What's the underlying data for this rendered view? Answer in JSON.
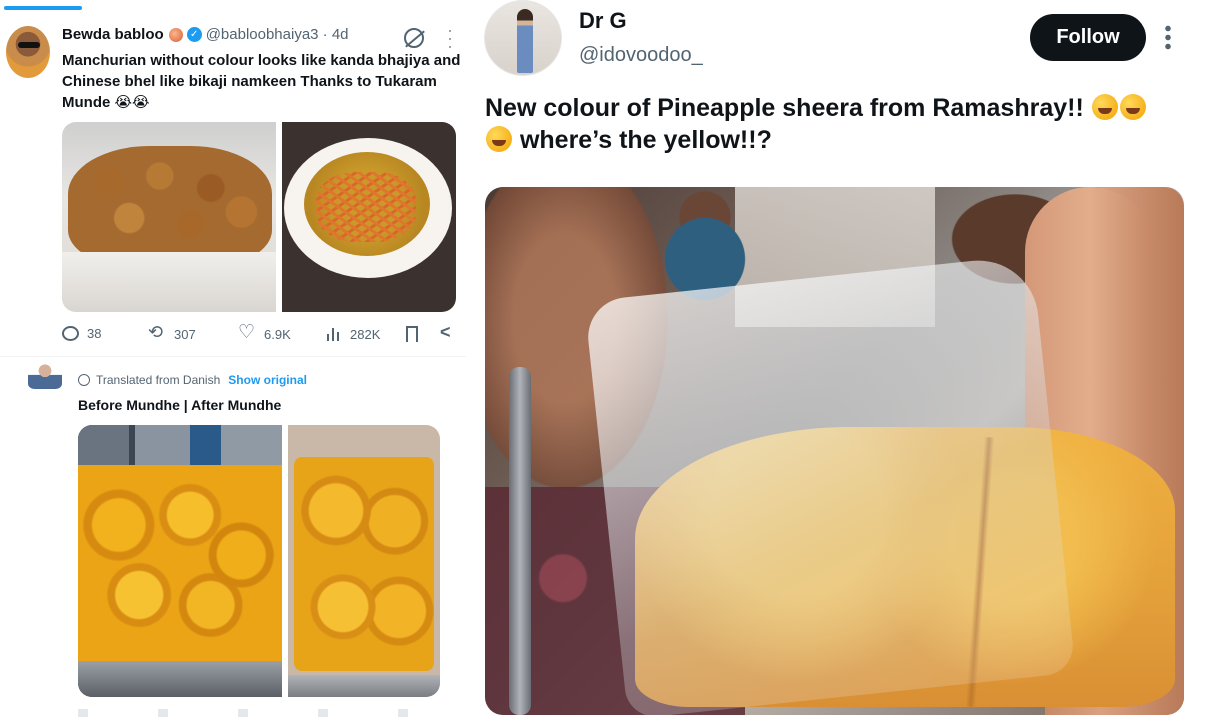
{
  "left": {
    "tweet1": {
      "name": "Bewda babloo",
      "handle": "@babloobhaiya3 · 4d",
      "text": "Manchurian without colour looks like kanda bhajiya and Chinese bhel like bikaji namkeen Thanks to Tukaram Munde 😭😭",
      "replies": "38",
      "reposts": "307",
      "likes": "6.9K",
      "views": "282K",
      "icons": [
        "verified-badge",
        "grok-icon",
        "more-icon",
        "reply-icon",
        "repost-icon",
        "like-icon",
        "views-icon",
        "bookmark-icon",
        "share-icon"
      ]
    },
    "tweet2": {
      "translated": "Translated from Danish",
      "show_original": "Show original",
      "text": "Before Mundhe | After Mundhe"
    }
  },
  "right": {
    "name": "Dr G",
    "handle": "@idovoodoo_",
    "follow_label": "Follow",
    "text_line1": "New colour of Pineapple sheera from Ramashray!!",
    "text_line2": "where’s the yellow!!?",
    "emojis": [
      "rofl-emoji",
      "rofl-emoji",
      "rofl-emoji"
    ]
  },
  "colors": {
    "accent": "#1d9bf0",
    "text": "#0f1419",
    "muted": "#536471",
    "follow_bg": "#0f1419"
  }
}
